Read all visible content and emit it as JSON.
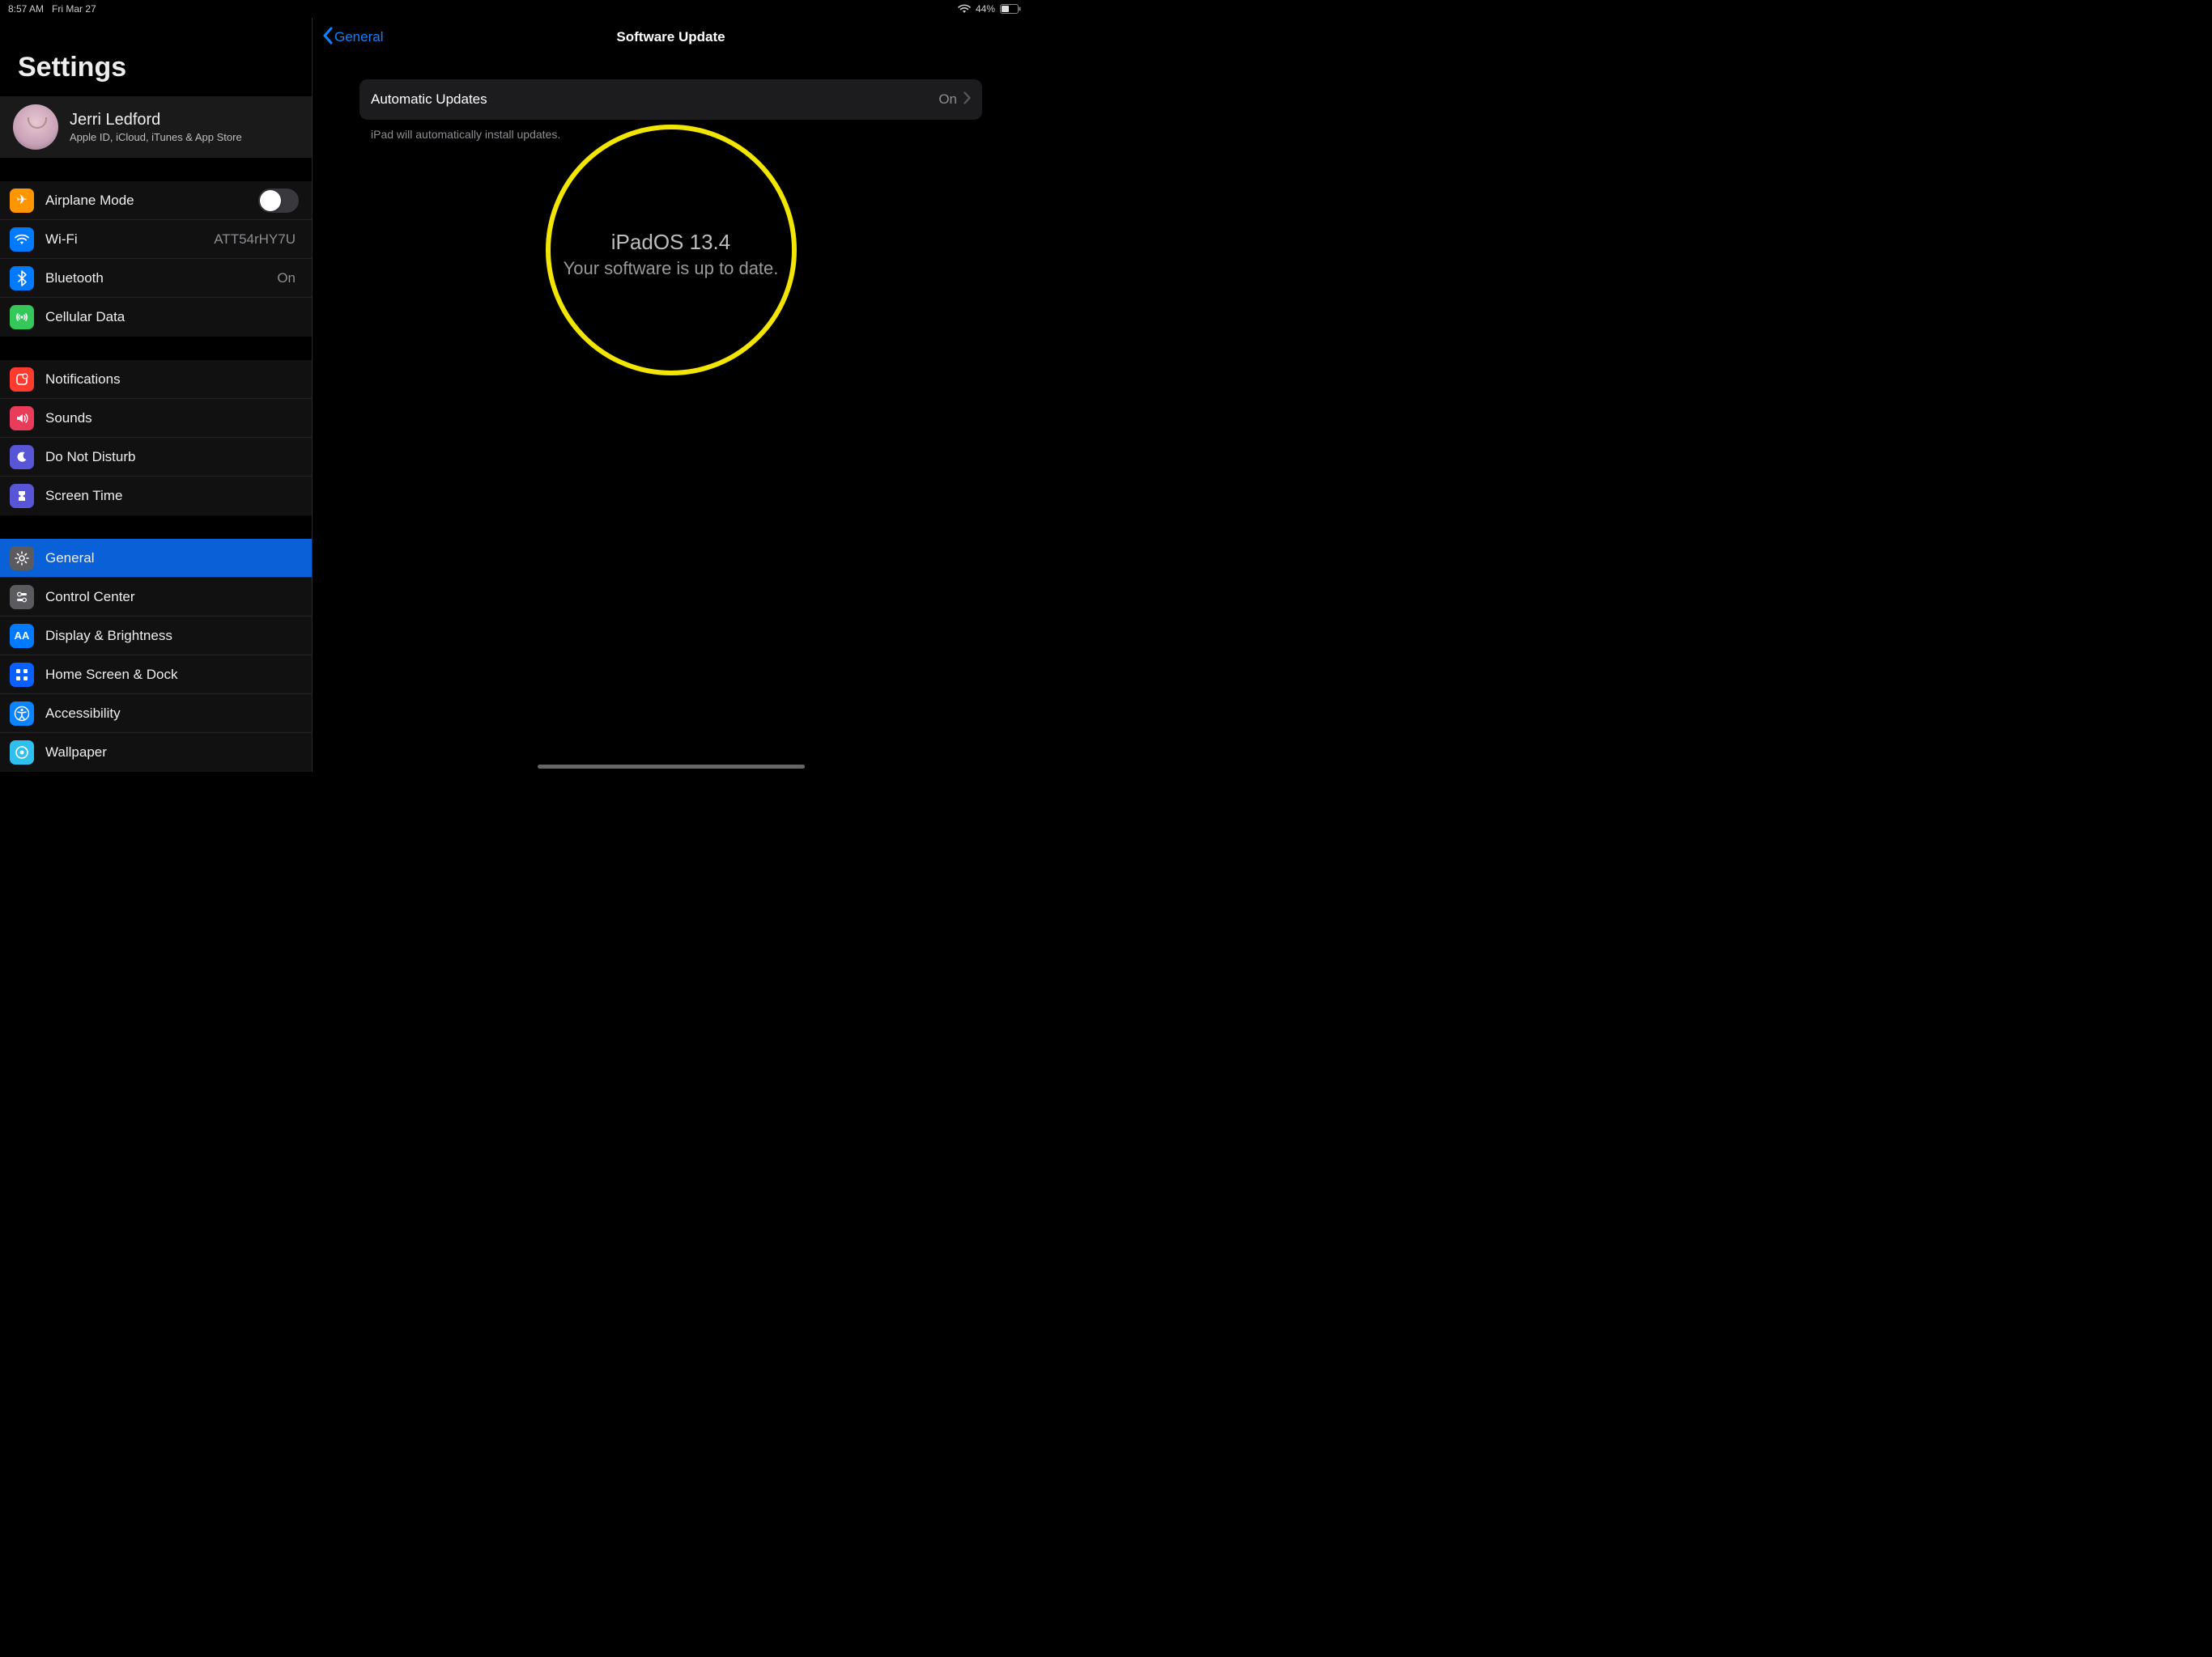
{
  "status_bar": {
    "time": "8:57 AM",
    "date": "Fri Mar 27",
    "battery_percent": "44%"
  },
  "sidebar": {
    "title": "Settings",
    "profile": {
      "name": "Jerri Ledford",
      "subtitle": "Apple ID, iCloud, iTunes & App Store"
    },
    "groups": [
      {
        "items": [
          {
            "id": "airplane",
            "label": "Airplane Mode",
            "icon": "airplane-icon",
            "type": "toggle",
            "toggle_on": false
          },
          {
            "id": "wifi",
            "label": "Wi-Fi",
            "icon": "wifi-icon",
            "type": "value",
            "value": "ATT54rHY7U"
          },
          {
            "id": "bluetooth",
            "label": "Bluetooth",
            "icon": "bluetooth-icon",
            "type": "value",
            "value": "On"
          },
          {
            "id": "cellular",
            "label": "Cellular Data",
            "icon": "cellular-icon",
            "type": "link"
          }
        ]
      },
      {
        "items": [
          {
            "id": "notifications",
            "label": "Notifications",
            "icon": "notifications-icon",
            "type": "link"
          },
          {
            "id": "sounds",
            "label": "Sounds",
            "icon": "sounds-icon",
            "type": "link"
          },
          {
            "id": "dnd",
            "label": "Do Not Disturb",
            "icon": "dnd-icon",
            "type": "link"
          },
          {
            "id": "screentime",
            "label": "Screen Time",
            "icon": "screentime-icon",
            "type": "link"
          }
        ]
      },
      {
        "items": [
          {
            "id": "general",
            "label": "General",
            "icon": "general-icon",
            "type": "link",
            "selected": true
          },
          {
            "id": "controlcenter",
            "label": "Control Center",
            "icon": "controlcenter-icon",
            "type": "link"
          },
          {
            "id": "display",
            "label": "Display & Brightness",
            "icon": "display-icon",
            "type": "link"
          },
          {
            "id": "homescreen",
            "label": "Home Screen & Dock",
            "icon": "homescreen-icon",
            "type": "link"
          },
          {
            "id": "accessibility",
            "label": "Accessibility",
            "icon": "accessibility-icon",
            "type": "link"
          },
          {
            "id": "wallpaper",
            "label": "Wallpaper",
            "icon": "wallpaper-icon",
            "type": "link"
          }
        ]
      }
    ]
  },
  "content": {
    "back_label": "General",
    "title": "Software Update",
    "auto_updates": {
      "label": "Automatic Updates",
      "value": "On",
      "footer": "iPad will automatically install updates."
    },
    "status": {
      "os_version": "iPadOS 13.4",
      "message": "Your software is up to date."
    }
  },
  "annotation": {
    "circle_color": "#f2e600"
  }
}
